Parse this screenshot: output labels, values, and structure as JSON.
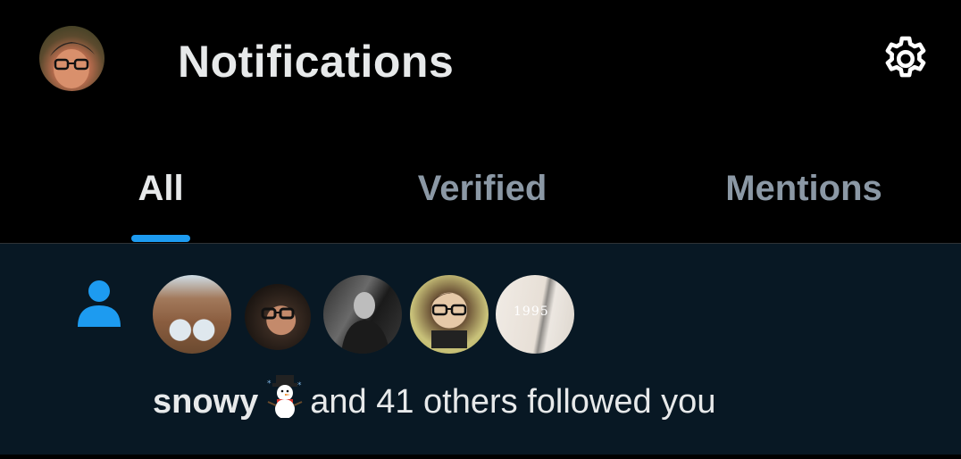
{
  "header": {
    "title": "Notifications",
    "settings_icon": "gear-icon",
    "avatar_icon": "profile-avatar"
  },
  "tabs": [
    {
      "label": "All",
      "active": true
    },
    {
      "label": "Verified",
      "active": false
    },
    {
      "label": "Mentions",
      "active": false
    }
  ],
  "notification": {
    "type_icon": "person-icon",
    "follower_avatars": [
      "follower-avatar-1",
      "follower-avatar-2",
      "follower-avatar-3",
      "follower-avatar-4",
      "follower-avatar-5"
    ],
    "avatar5_text": "1995",
    "name": "snowy",
    "name_emoji": "snowman-icon",
    "rest_text": "and 41 others followed you"
  },
  "colors": {
    "background": "#000000",
    "notification_bg": "#081824",
    "accent": "#1d9bf0",
    "text_primary": "#e7e9ea",
    "text_secondary": "#8b98a5"
  }
}
